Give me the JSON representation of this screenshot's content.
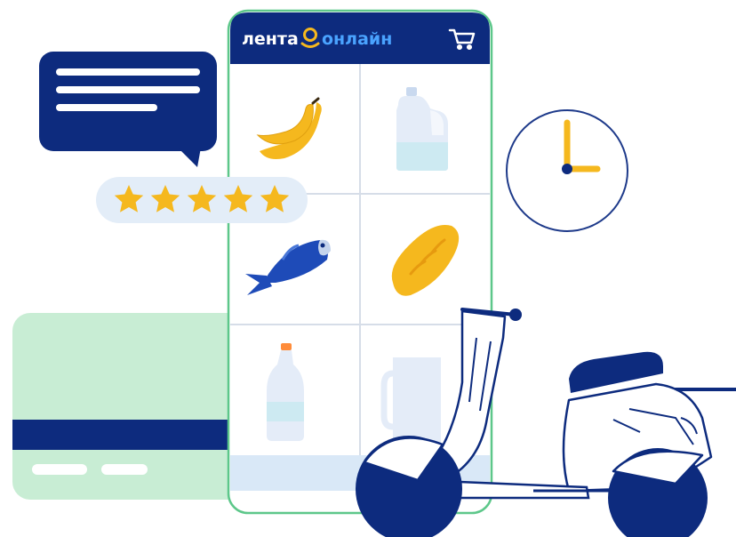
{
  "brand": {
    "name_part1": "лента",
    "name_part2": "онлайн"
  },
  "rating": {
    "stars": 5,
    "max": 5
  },
  "icons": {
    "cart": "shopping-cart-icon",
    "logo_mark": "flower-logo-icon",
    "clock": "clock-icon",
    "scooter": "scooter-icon",
    "card": "credit-card-icon",
    "chat": "chat-bubble-icon"
  },
  "products": [
    "banana",
    "milk-jug",
    "fish",
    "bread-loaf",
    "water-bottle",
    "glass-jug"
  ],
  "colors": {
    "navy": "#0d2b7e",
    "yellow": "#f5b81e",
    "light_blue": "#d9e8f7",
    "mint": "#c8edd4",
    "phone_border": "#5dc78a",
    "grid": "#d6dde8"
  }
}
